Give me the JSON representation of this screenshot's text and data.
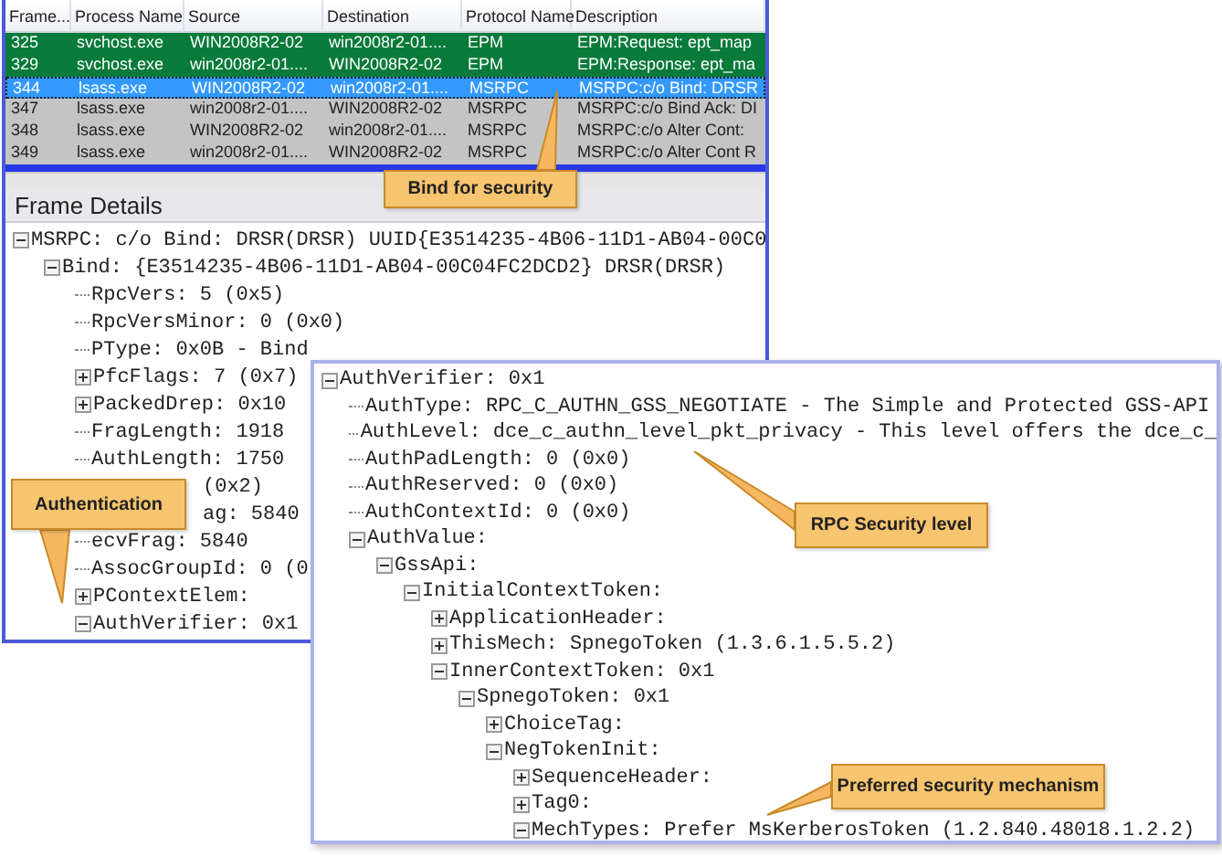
{
  "table": {
    "columns": [
      "Frame...",
      "Process Name",
      "Source",
      "Destination",
      "Protocol Name",
      "Description"
    ],
    "rows": [
      {
        "cells": [
          "325",
          "svchost.exe",
          "WIN2008R2-02",
          "win2008r2-01....",
          "EPM",
          "EPM:Request: ept_map"
        ],
        "selected": false,
        "color": "#087a3a"
      },
      {
        "cells": [
          "329",
          "svchost.exe",
          "win2008r2-01....",
          "WIN2008R2-02",
          "EPM",
          "EPM:Response: ept_ma"
        ],
        "selected": false,
        "color": "#087a3a"
      },
      {
        "cells": [
          "344",
          "lsass.exe",
          "WIN2008R2-02",
          "win2008r2-01....",
          "MSRPC",
          "MSRPC:c/o Bind: DRSR"
        ],
        "selected": true,
        "color": "#3399ff"
      },
      {
        "cells": [
          "347",
          "lsass.exe",
          "win2008r2-01....",
          "WIN2008R2-02",
          "MSRPC",
          "MSRPC:c/o Bind Ack: DI"
        ],
        "selected": false,
        "color": "#c4c4c4"
      },
      {
        "cells": [
          "348",
          "lsass.exe",
          "WIN2008R2-02",
          "win2008r2-01....",
          "MSRPC",
          "MSRPC:c/o Alter Cont:"
        ],
        "selected": false,
        "color": "#c4c4c4"
      },
      {
        "cells": [
          "349",
          "lsass.exe",
          "win2008r2-01....",
          "WIN2008R2-02",
          "MSRPC",
          "MSRPC:c/o Alter Cont R"
        ],
        "selected": false,
        "color": "#c4c4c4"
      }
    ]
  },
  "frame_details": {
    "title": "Frame Details",
    "tree": [
      {
        "text": "MSRPC: c/o Bind: DRSR(DRSR) UUID{E3514235-4B06-11D1-AB04-00C0",
        "expanded": true,
        "children": [
          {
            "text": "Bind: {E3514235-4B06-11D1-AB04-00C04FC2DCD2} DRSR(DRSR)",
            "expanded": true,
            "children": [
              {
                "text": "RpcVers: 5 (0x5)"
              },
              {
                "text": "RpcVersMinor: 0 (0x0)"
              },
              {
                "text": "PType: 0x0B - Bind"
              },
              {
                "text": "PfcFlags: 7 (0x7)",
                "expanded": false
              },
              {
                "text": "PackedDrep: 0x10",
                "expanded": false
              },
              {
                "text": "FragLength: 1918"
              },
              {
                "text": "AuthLength: 1750"
              },
              {
                "text": "(0x2)",
                "kind": "cut"
              },
              {
                "text": "ag: 5840",
                "kind": "cut"
              },
              {
                "text": "ecvFrag: 5840"
              },
              {
                "text": "AssocGroupId: 0 (0"
              },
              {
                "text": "PContextElem:",
                "expanded": false
              },
              {
                "text": "AuthVerifier: 0x1",
                "expanded": true
              }
            ]
          }
        ]
      }
    ]
  },
  "zoom_panel": {
    "tree": [
      {
        "text": "AuthVerifier: 0x1",
        "expanded": true,
        "children": [
          {
            "text": "AuthType: RPC_C_AUTHN_GSS_NEGOTIATE - The Simple and Protected GSS-API"
          },
          {
            "text": "AuthLevel: dce_c_authn_level_pkt_privacy - This level offers the dce_c_"
          },
          {
            "text": "AuthPadLength: 0 (0x0)"
          },
          {
            "text": "AuthReserved: 0 (0x0)"
          },
          {
            "text": "AuthContextId: 0 (0x0)"
          },
          {
            "text": "AuthValue:",
            "expanded": true,
            "children": [
              {
                "text": "GssApi:",
                "expanded": true,
                "children": [
                  {
                    "text": "InitialContextToken:",
                    "expanded": true,
                    "children": [
                      {
                        "text": "ApplicationHeader:",
                        "expanded": false
                      },
                      {
                        "text": "ThisMech: SpnegoToken (1.3.6.1.5.5.2)",
                        "expanded": false
                      },
                      {
                        "text": "InnerContextToken: 0x1",
                        "expanded": true,
                        "children": [
                          {
                            "text": "SpnegoToken: 0x1",
                            "expanded": true,
                            "children": [
                              {
                                "text": "ChoiceTag:",
                                "expanded": false
                              },
                              {
                                "text": "NegTokenInit:",
                                "expanded": true,
                                "children": [
                                  {
                                    "text": "SequenceHeader:",
                                    "expanded": false
                                  },
                                  {
                                    "text": "Tag0:",
                                    "expanded": false
                                  },
                                  {
                                    "text": "MechTypes: Prefer MsKerberosToken (1.2.840.48018.1.2.2)",
                                    "expanded": true
                                  }
                                ]
                              }
                            ]
                          }
                        ]
                      }
                    ]
                  }
                ]
              }
            ]
          }
        ]
      }
    ]
  },
  "callouts": [
    {
      "text": "Bind for security"
    },
    {
      "text": "Authentication"
    },
    {
      "text": "RPC Security level"
    },
    {
      "text": "Preferred security mechanism"
    }
  ]
}
